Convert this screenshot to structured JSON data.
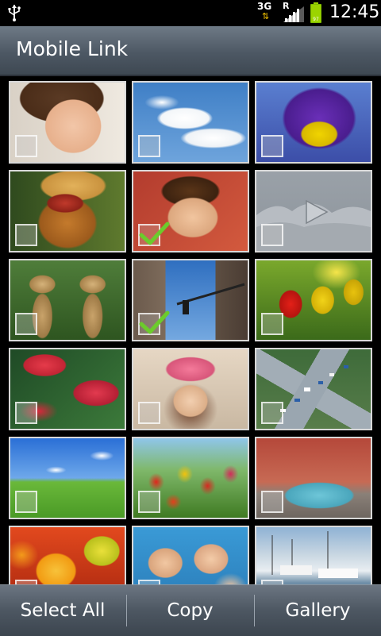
{
  "status_bar": {
    "network": "3G",
    "roaming": "R",
    "battery_level": "97",
    "time": "12:45",
    "icons": [
      "usb-icon",
      "data-arrows-icon",
      "signal-icon",
      "battery-icon"
    ]
  },
  "title_bar": {
    "title": "Mobile Link"
  },
  "grid": {
    "items": [
      {
        "subject": "surprised-child-photo",
        "type": "image",
        "checked": false
      },
      {
        "subject": "clouds-sky-photo",
        "type": "image",
        "checked": false
      },
      {
        "subject": "purple-iris-photo",
        "type": "image",
        "checked": false
      },
      {
        "subject": "dog-with-hat-photo",
        "type": "image",
        "checked": false
      },
      {
        "subject": "smiling-boy-photo",
        "type": "image",
        "checked": true
      },
      {
        "subject": "mountains-video-thumbnail",
        "type": "video",
        "checked": false
      },
      {
        "subject": "giraffes-photo",
        "type": "image",
        "checked": false
      },
      {
        "subject": "city-traffic-light-photo",
        "type": "image",
        "checked": true
      },
      {
        "subject": "tulips-photo",
        "type": "image",
        "checked": false
      },
      {
        "subject": "red-flowers-photo",
        "type": "image",
        "checked": false
      },
      {
        "subject": "girl-pink-hat-photo",
        "type": "image",
        "checked": false
      },
      {
        "subject": "city-intersection-photo",
        "type": "image",
        "checked": false
      },
      {
        "subject": "green-field-sky-photo",
        "type": "image",
        "checked": false
      },
      {
        "subject": "tulip-field-photo",
        "type": "image",
        "checked": false
      },
      {
        "subject": "blue-car-photo",
        "type": "image",
        "checked": false
      },
      {
        "subject": "fruits-photo",
        "type": "image",
        "checked": false
      },
      {
        "subject": "kids-faces-photo",
        "type": "image",
        "checked": false
      },
      {
        "subject": "harbor-boats-photo",
        "type": "image",
        "checked": false
      }
    ]
  },
  "bottom_bar": {
    "select_all": "Select All",
    "copy": "Copy",
    "gallery": "Gallery"
  },
  "colors": {
    "checkmark": "#6ccb2c",
    "titlebar": "#4d5864",
    "thumb_border": "#d8d8d8"
  }
}
